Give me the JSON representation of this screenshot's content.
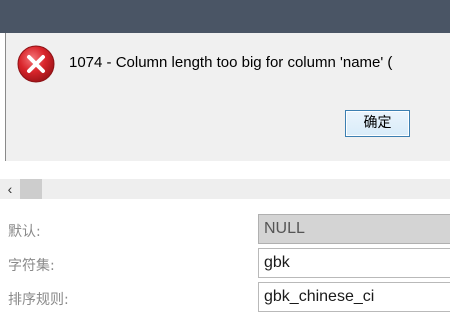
{
  "dialog": {
    "message": "1074 - Column length too big for column 'name' (",
    "ok_label": "确定"
  },
  "scrollbar": {
    "left_arrow": "‹"
  },
  "form": {
    "rows": [
      {
        "label": "默认:",
        "value": "NULL"
      },
      {
        "label": "字符集:",
        "value": "gbk"
      },
      {
        "label": "排序规则:",
        "value": "gbk_chinese_ci"
      }
    ]
  },
  "colors": {
    "error_red": "#d9252b",
    "titlebar": "#4a5565"
  },
  "icons": {
    "dialog_icon": "error-icon"
  }
}
